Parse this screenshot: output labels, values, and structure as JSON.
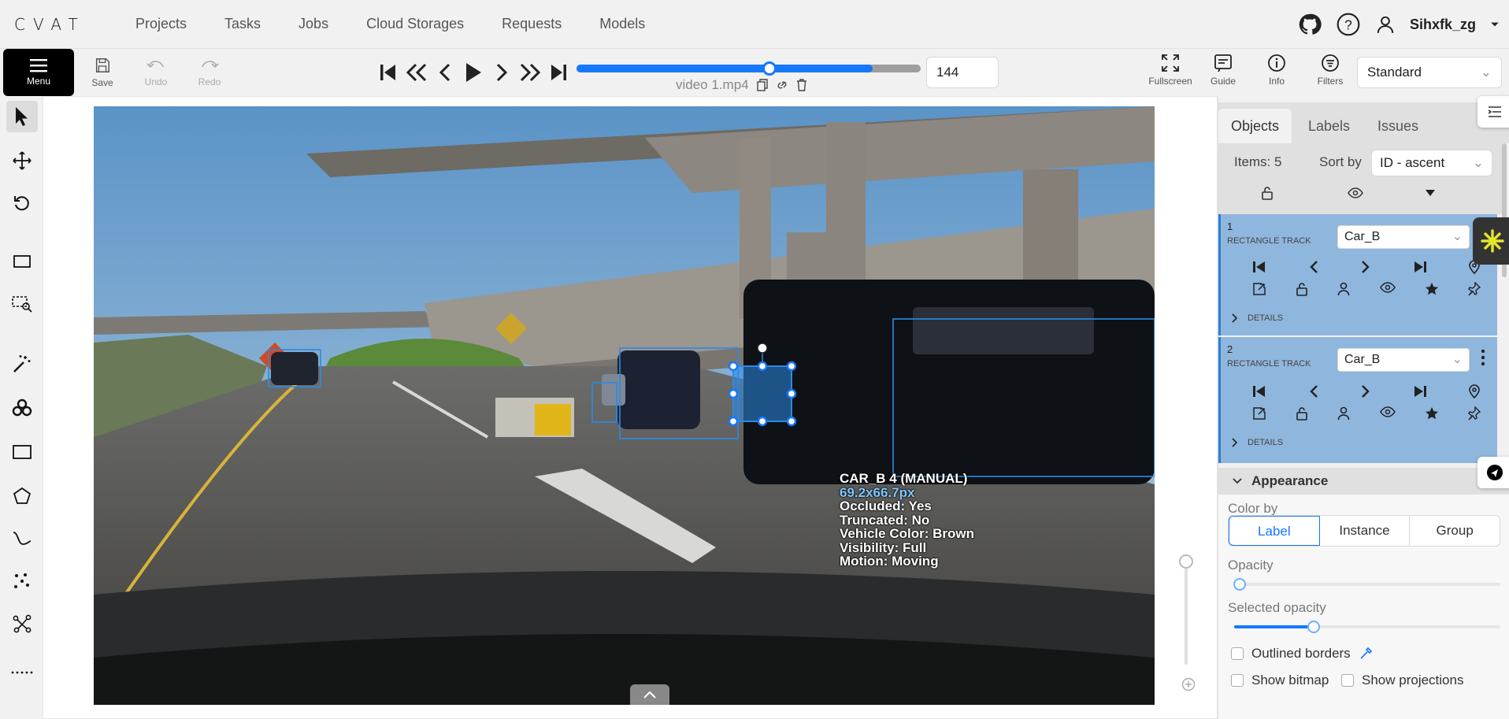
{
  "nav": {
    "logo": "CVAT",
    "links": [
      "Projects",
      "Tasks",
      "Jobs",
      "Cloud Storages",
      "Requests",
      "Models"
    ],
    "user": "Sihxfk_zg"
  },
  "toolbar": {
    "menu_label": "Menu",
    "save_label": "Save",
    "undo_label": "Undo",
    "redo_label": "Redo",
    "filename": "video 1.mp4",
    "frame_number": "144",
    "frame_progress": 0.56,
    "buffer_progress": 0.86,
    "fullscreen_label": "Fullscreen",
    "guide_label": "Guide",
    "info_label": "Info",
    "filters_label": "Filters",
    "workspace": "Standard"
  },
  "canvas": {
    "object_label_title": "CAR_B 4 (MANUAL)",
    "object_label_dims": "69.2x66.7px",
    "attributes": [
      "Occluded: Yes",
      "Truncated: No",
      "Vehicle Color: Brown",
      "Visibility: Full",
      "Motion: Moving"
    ]
  },
  "sidebar": {
    "tabs": [
      "Objects",
      "Labels",
      "Issues"
    ],
    "items_count": "Items: 5",
    "sort_by_label": "Sort by",
    "sort_value": "ID - ascent",
    "objects": [
      {
        "id": "1",
        "type": "RECTANGLE TRACK",
        "label": "Car_B",
        "details": "DETAILS"
      },
      {
        "id": "2",
        "type": "RECTANGLE TRACK",
        "label": "Car_B",
        "details": "DETAILS"
      }
    ]
  },
  "appearance": {
    "title": "Appearance",
    "color_by_label": "Color by",
    "color_by_options": [
      "Label",
      "Instance",
      "Group"
    ],
    "color_by_selected": "Label",
    "opacity_label": "Opacity",
    "opacity_value": 0.02,
    "selected_opacity_label": "Selected opacity",
    "selected_opacity_value": 0.3,
    "outlined_borders_label": "Outlined borders",
    "show_bitmap_label": "Show bitmap",
    "show_projections_label": "Show projections"
  },
  "colors": {
    "accent": "#1677ff",
    "object_card": "#8fb6dd",
    "box_stroke": "#2b8ae6"
  }
}
